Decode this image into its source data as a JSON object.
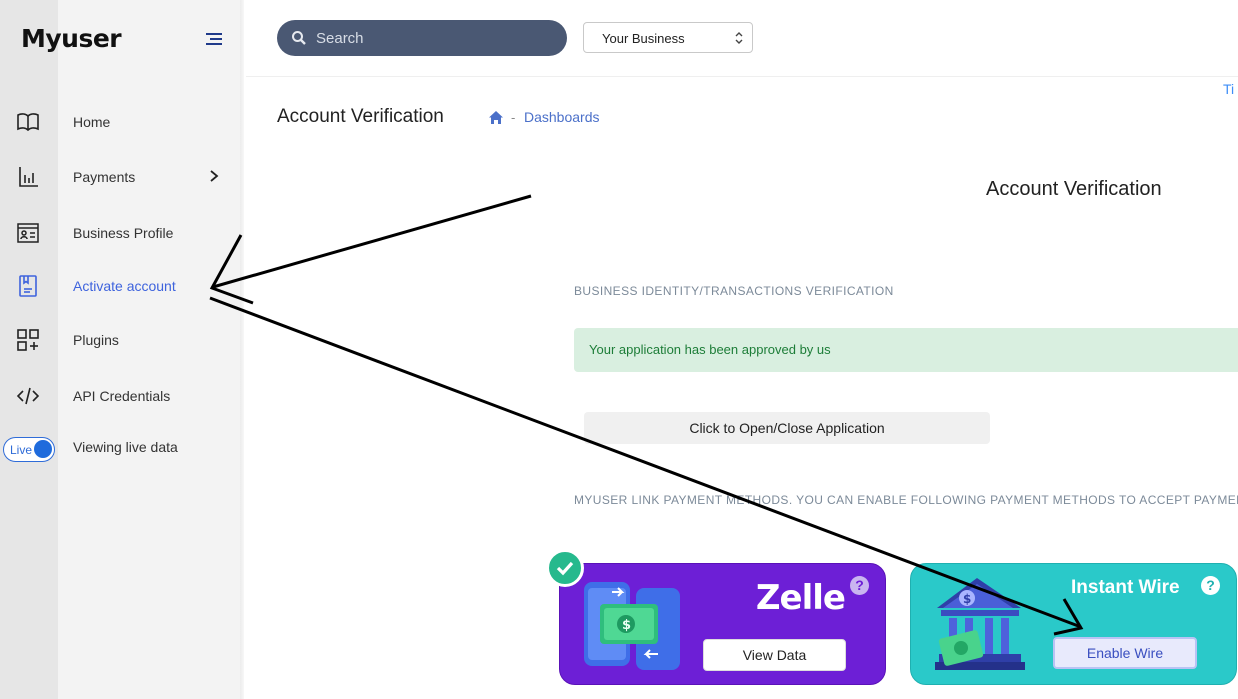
{
  "app": {
    "logo": "Myuser"
  },
  "sidebar": {
    "items": [
      {
        "label": "Home",
        "icon": "book-icon"
      },
      {
        "label": "Payments",
        "icon": "bar-chart-icon"
      },
      {
        "label": "Business Profile",
        "icon": "id-card-icon"
      },
      {
        "label": "Activate account",
        "icon": "document-icon",
        "active": true
      },
      {
        "label": "Plugins",
        "icon": "grid-plus-icon"
      },
      {
        "label": "API Credentials",
        "icon": "code-icon"
      }
    ],
    "live_toggle": {
      "label": "Live",
      "text": "Viewing live data",
      "on": true
    }
  },
  "header": {
    "search_placeholder": "Search",
    "business_select": "Your Business",
    "corner_link": "Ti"
  },
  "page": {
    "title": "Account Verification",
    "breadcrumb": {
      "sep": "-",
      "link": "Dashboards"
    },
    "section_title": "Account Verification",
    "identity_label": "BUSINESS IDENTITY/TRANSACTIONS VERIFICATION",
    "alert": "Your application has been approved by us",
    "toggle_button": "Click to Open/Close Application",
    "methods_label": "MYUSER LINK PAYMENT METHODS. YOU CAN ENABLE FOLLOWING PAYMENT METHODS TO ACCEPT PAYMEN"
  },
  "cards": {
    "zelle": {
      "name": "Zelle",
      "button": "View Data",
      "enabled": true,
      "color": "#6d1fd6"
    },
    "wire": {
      "name": "Instant Wire",
      "button": "Enable Wire",
      "color": "#2ac9c9"
    }
  },
  "colors": {
    "accent": "#3e63dd",
    "success": "#1d7d38",
    "search_bg": "#4a5873"
  }
}
